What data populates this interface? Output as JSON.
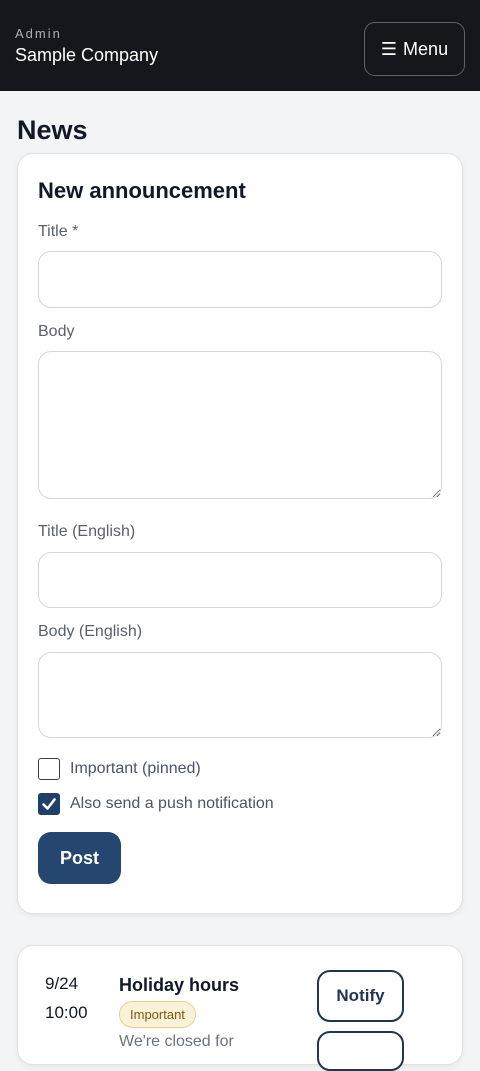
{
  "header": {
    "subtitle": "Admin",
    "company": "Sample Company",
    "menu_icon": "☰",
    "menu_label": "Menu"
  },
  "page": {
    "title": "News"
  },
  "form": {
    "heading": "New announcement",
    "title_label": "Title *",
    "title_value": "",
    "body_label": "Body",
    "body_value": "",
    "title_en_label": "Title (English)",
    "title_en_value": "",
    "body_en_label": "Body (English)",
    "body_en_value": "",
    "important_label": "Important (pinned)",
    "important_checked": false,
    "push_label": "Also send a push notification",
    "push_checked": true,
    "post_label": "Post"
  },
  "news": {
    "items": [
      {
        "date": "9/24",
        "time": "10:00",
        "title": "Holiday hours",
        "badge": "Important",
        "excerpt": "We're closed for",
        "notify_label": "Notify"
      }
    ]
  },
  "colors": {
    "topbar": "#14181d",
    "primary": "#24466f",
    "badge_bg": "#fbf1d6",
    "badge_border": "#e7cf8f"
  }
}
